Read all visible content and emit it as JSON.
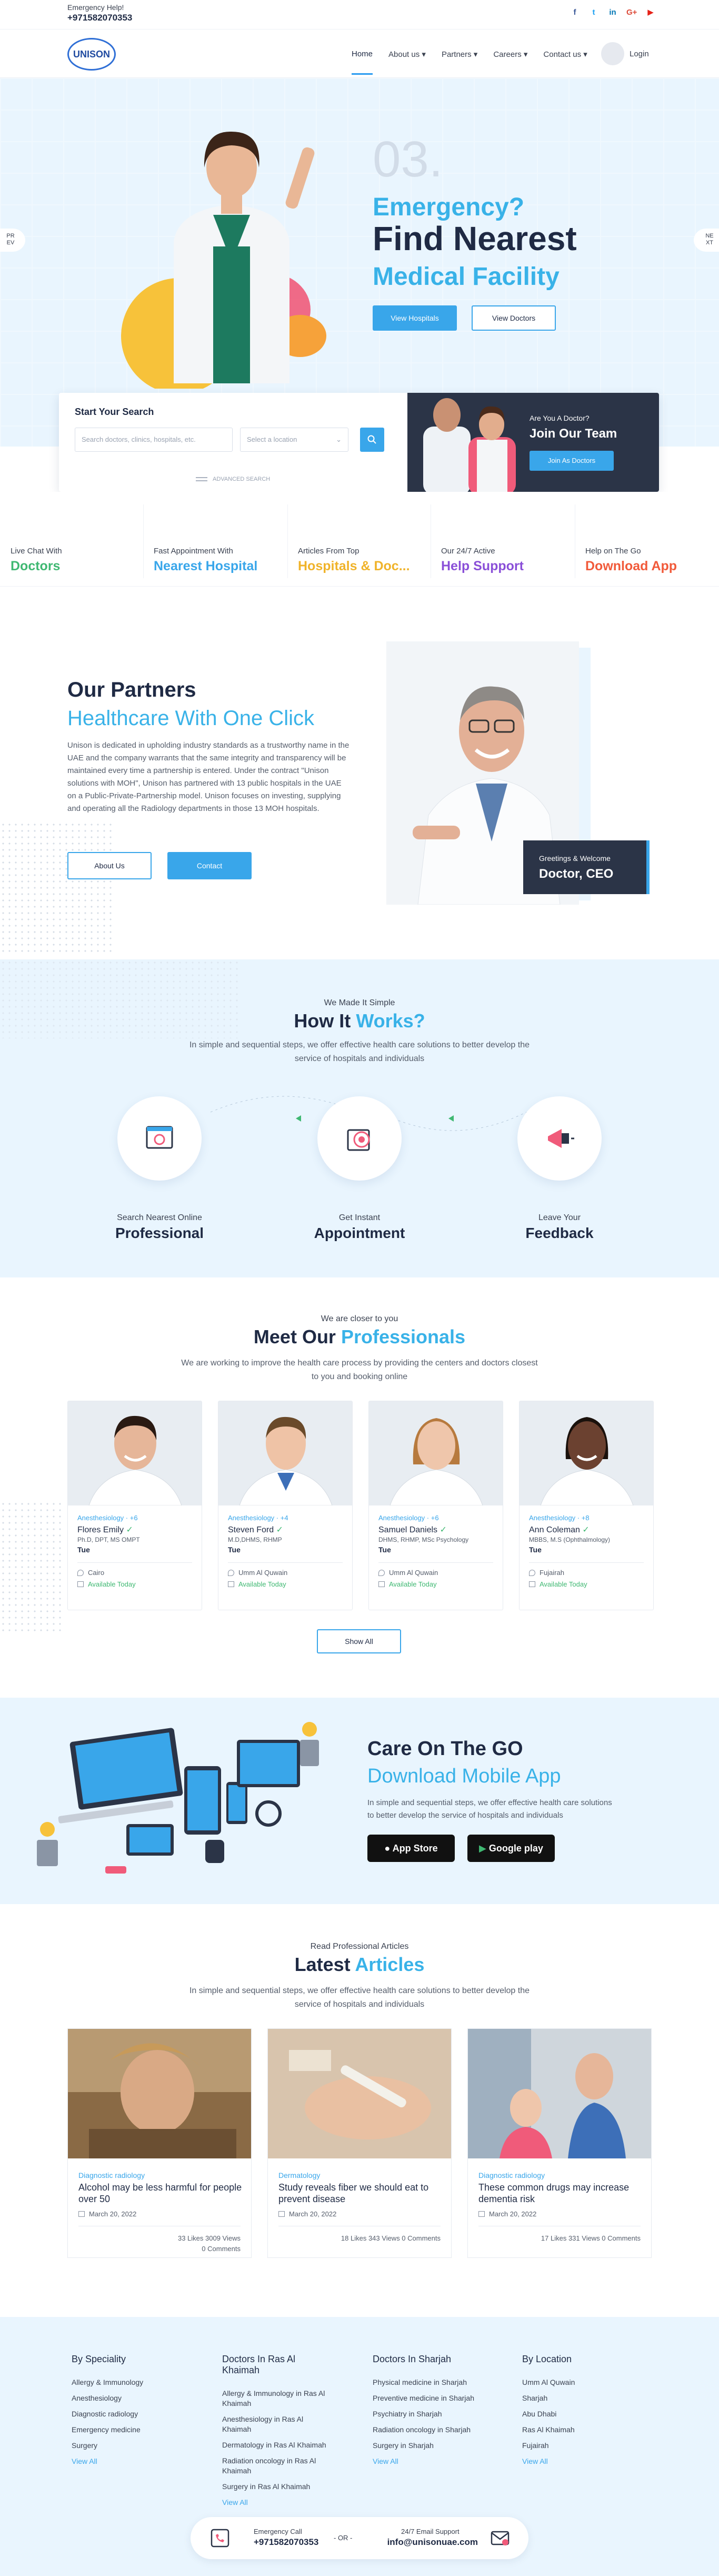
{
  "topbar": {
    "emergency_label": "Emergency Help!",
    "emergency_phone": "+971582070353",
    "social": [
      "f",
      "t",
      "in",
      "G+",
      "▶"
    ]
  },
  "nav": {
    "logo": "UNISON",
    "menu": [
      "Home",
      "About us",
      "Partners",
      "Careers",
      "Contact us"
    ],
    "login": "Login"
  },
  "hero": {
    "number": "03.",
    "line1": "Emergency?",
    "line2": "Find Nearest",
    "line3": "Medical Facility",
    "btn_hospitals": "View Hospitals",
    "btn_doctors": "View Doctors",
    "prev": "PR EV",
    "next": "NE XT"
  },
  "search": {
    "title": "Start Your Search",
    "placeholder": "Search doctors, clinics, hospitals, etc.",
    "location": "Select a location",
    "advanced": "ADVANCED SEARCH",
    "doctor_q": "Are You A Doctor?",
    "doctor_title": "Join Our Team",
    "doctor_btn": "Join As Doctors"
  },
  "features": [
    {
      "small": "Live Chat With",
      "big": "Doctors",
      "color": "#3fb872"
    },
    {
      "small": "Fast Appointment With",
      "big": "Nearest Hospital",
      "color": "#39a6ea"
    },
    {
      "small": "Articles From Top",
      "big": "Hospitals & Doc...",
      "color": "#f0b32a"
    },
    {
      "small": "Our 24/7 Active",
      "big": "Help Support",
      "color": "#8a4fd8"
    },
    {
      "small": "Help on The Go",
      "big": "Download App",
      "color": "#f15a3a"
    }
  ],
  "partners": {
    "title1": "Our Partners",
    "title2": "Healthcare With One Click",
    "body": "Unison is dedicated in upholding industry standards as a trustworthy name in the UAE and the company warrants that the same integrity and transparency will be maintained every time a partnership is entered. Under the contract \"Unison solutions with MOH\", Unison has partnered with 13 public hospitals in the UAE on a Public-Private-Partnership model. Unison focuses on investing, supplying and operating all the Radiology departments in those 13 MOH hospitals.",
    "btn_about": "About Us",
    "btn_contact": "Contact",
    "ceo_small": "Greetings & Welcome",
    "ceo_big": "Doctor, CEO"
  },
  "how": {
    "small": "We Made It Simple",
    "title": "How It",
    "title_accent": "Works?",
    "desc1": "In simple and sequential steps, we offer effective health care solutions to better develop the",
    "desc2": "service of hospitals and individuals",
    "steps": [
      {
        "small": "Search Nearest Online",
        "big": "Professional",
        "icon": "browser-search-icon"
      },
      {
        "small": "Get Instant",
        "big": "Appointment",
        "icon": "target-calendar-icon"
      },
      {
        "small": "Leave Your",
        "big": "Feedback",
        "icon": "megaphone-icon"
      }
    ]
  },
  "pros": {
    "small": "We are closer to you",
    "title": "Meet Our",
    "title_accent": "Professionals",
    "desc1": "We are working to improve the health care process by providing the centers and doctors closest",
    "desc2": "to you and booking online",
    "show_all": "Show All",
    "cards": [
      {
        "tag": "Anesthesiology",
        "extra": "+6",
        "name": "Flores Emily",
        "deg": "Ph.D, DPT, MS OMPT",
        "day": "Tue",
        "loc": "Cairo",
        "avail": "Available Today"
      },
      {
        "tag": "Anesthesiology",
        "extra": "+4",
        "name": "Steven Ford",
        "deg": "M.D,DHMS, RHMP",
        "day": "Tue",
        "loc": "Umm Al Quwain",
        "avail": "Available Today"
      },
      {
        "tag": "Anesthesiology",
        "extra": "+6",
        "name": "Samuel Daniels",
        "deg": "DHMS, RHMP, MSc Psychology",
        "day": "Tue",
        "loc": "Umm Al Quwain",
        "avail": "Available Today"
      },
      {
        "tag": "Anesthesiology",
        "extra": "+8",
        "name": "Ann Coleman",
        "deg": "MBBS, M.S (Ophthalmology)",
        "day": "Tue",
        "loc": "Fujairah",
        "avail": "Available Today"
      }
    ]
  },
  "mobile": {
    "title1": "Care On The GO",
    "title2": "Download Mobile App",
    "desc1": "In simple and sequential steps, we offer effective health care solutions",
    "desc2": "to better develop the service of hospitals and individuals",
    "appstore": "App Store",
    "googleplay": "Google play"
  },
  "articles": {
    "small": "Read Professional Articles",
    "title": "Latest",
    "title_accent": "Articles",
    "desc1": "In simple and sequential steps, we offer effective health care solutions to better develop the",
    "desc2": "service of hospitals and individuals",
    "items": [
      {
        "cat": "Diagnostic radiology",
        "title": "Alcohol may be less harmful for people over 50",
        "date": "March 20, 2022",
        "stats1": "33 Likes   3009 Views",
        "stats2": "0 Comments"
      },
      {
        "cat": "Dermatology",
        "title": "Study reveals fiber we should eat to prevent disease",
        "date": "March 20, 2022",
        "stats1": "18 Likes   343 Views   0 Comments",
        "stats2": ""
      },
      {
        "cat": "Diagnostic radiology",
        "title": "These common drugs may increase dementia risk",
        "date": "March 20, 2022",
        "stats1": "17 Likes   331 Views   0 Comments",
        "stats2": ""
      }
    ]
  },
  "footer": {
    "cols": [
      {
        "title": "By Speciality",
        "items": [
          "Allergy & Immunology",
          "Anesthesiology",
          "Diagnostic radiology",
          "Emergency medicine",
          "Surgery"
        ],
        "more": "View All"
      },
      {
        "title": "Doctors In Ras Al Khaimah",
        "items": [
          "Allergy & Immunology in Ras Al Khaimah",
          "Anesthesiology in Ras Al Khaimah",
          "Dermatology in Ras Al Khaimah",
          "Radiation oncology in Ras Al Khaimah",
          "Surgery in Ras Al Khaimah"
        ],
        "more": "View All"
      },
      {
        "title": "Doctors In Sharjah",
        "items": [
          "Physical medicine in Sharjah",
          "Preventive medicine in Sharjah",
          "Psychiatry in Sharjah",
          "Radiation oncology in Sharjah",
          "Surgery in Sharjah"
        ],
        "more": "View All"
      },
      {
        "title": "By Location",
        "items": [
          "Umm Al Quwain",
          "Sharjah",
          "Abu Dhabi",
          "Ras Al Khaimah",
          "Fujairah"
        ],
        "more": "View All"
      }
    ],
    "call_label": "Emergency Call",
    "call_phone": "+971582070353",
    "or": "- OR -",
    "email_label": "24/7 Email Support",
    "email": "info@unisonuae.com"
  },
  "colors": {
    "accent": "#39a6ea",
    "navy": "#1f2a44",
    "light_bg": "#e9f5fe"
  }
}
